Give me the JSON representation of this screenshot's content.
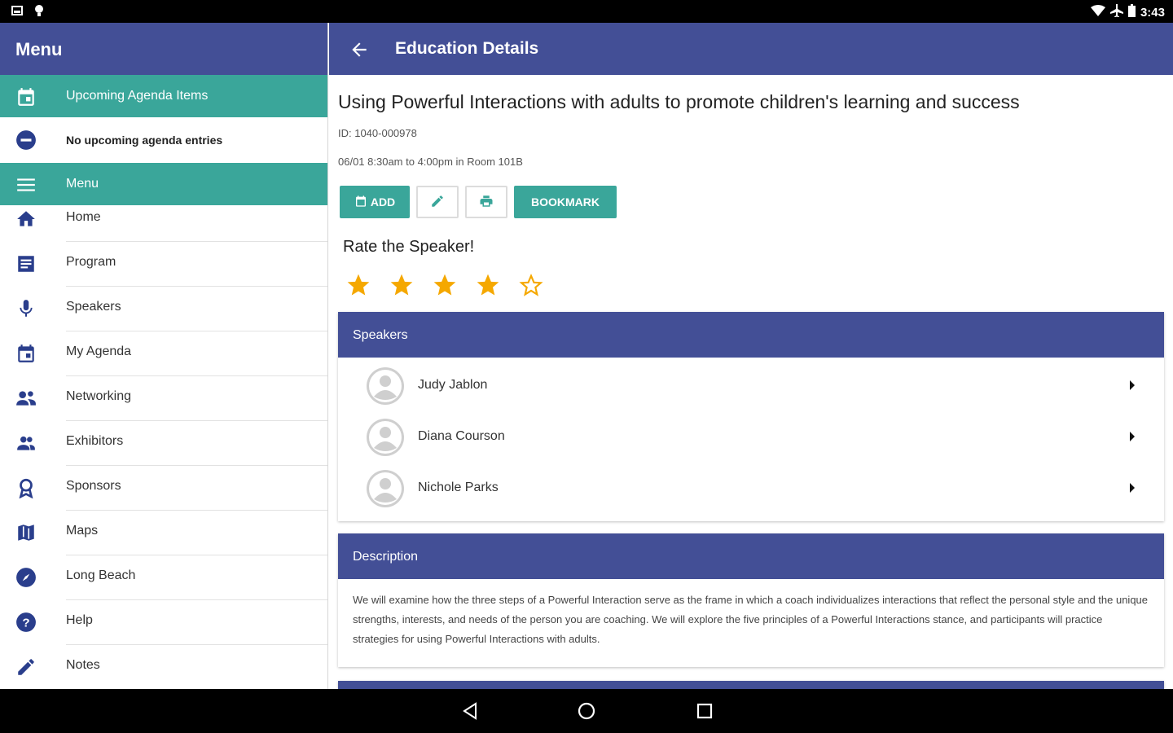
{
  "status_bar": {
    "time": "3:43"
  },
  "sidebar": {
    "title": "Menu",
    "upcoming_header": "Upcoming Agenda Items",
    "upcoming_empty": "No upcoming agenda entries",
    "menu_header": "Menu",
    "items": [
      {
        "label": "Home",
        "icon": "home-icon"
      },
      {
        "label": "Program",
        "icon": "program-icon"
      },
      {
        "label": "Speakers",
        "icon": "microphone-icon"
      },
      {
        "label": "My Agenda",
        "icon": "calendar-icon"
      },
      {
        "label": "Networking",
        "icon": "networking-icon"
      },
      {
        "label": "Exhibitors",
        "icon": "people-icon"
      },
      {
        "label": "Sponsors",
        "icon": "award-icon"
      },
      {
        "label": "Maps",
        "icon": "map-icon"
      },
      {
        "label": "Long Beach",
        "icon": "compass-icon"
      },
      {
        "label": "Help",
        "icon": "help-icon"
      },
      {
        "label": "Notes",
        "icon": "pencil-icon"
      }
    ]
  },
  "main": {
    "title": "Education Details",
    "session_title": "Using Powerful Interactions with adults to promote children's learning and success",
    "session_id": "ID: 1040-000978",
    "session_time": "06/01 8:30am to 4:00pm in Room 101B",
    "buttons": {
      "add": "ADD",
      "bookmark": "BOOKMARK"
    },
    "rate_label": "Rate the Speaker!",
    "rating": {
      "value": 4,
      "max": 5
    },
    "speakers_header": "Speakers",
    "speakers": [
      "Judy Jablon",
      "Diana Courson",
      "Nichole Parks"
    ],
    "description_header": "Description",
    "description": "We will examine how the three steps of a Powerful Interaction serve as the frame in which a coach individualizes interactions that reflect the personal style and the unique strengths, interests, and needs of the person you are coaching. We will explore the five principles of a Powerful Interactions stance, and participants will practice strategies for using Powerful Interactions with adults."
  },
  "colors": {
    "primary": "#434f96",
    "accent": "#3aa69a",
    "star": "#f5a800"
  }
}
